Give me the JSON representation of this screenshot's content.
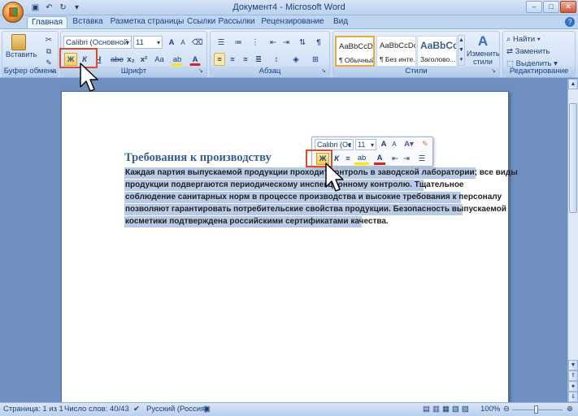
{
  "window": {
    "title": "Документ4 - Microsoft Word"
  },
  "quick_access": [
    "save",
    "undo",
    "redo",
    "customize"
  ],
  "tabs": [
    "Главная",
    "Вставка",
    "Разметка страницы",
    "Ссылки",
    "Рассылки",
    "Рецензирование",
    "Вид"
  ],
  "ribbon": {
    "clipboard": {
      "label": "Буфер обмена",
      "paste_label": "Вставить"
    },
    "font": {
      "label": "Шрифт",
      "font_name": "Calibri (Основной те",
      "font_size": "11",
      "bold_glyph": "Ж",
      "italic_glyph": "К",
      "underline_glyph": "Ч",
      "strike_glyph": "abe",
      "sub_glyph": "x₂",
      "sup_glyph": "x²",
      "case_glyph": "Aa",
      "grow_glyph": "A",
      "shrink_glyph": "A"
    },
    "paragraph": {
      "label": "Абзац"
    },
    "styles": {
      "label": "Стили",
      "cards": [
        {
          "sample": "AaBbCcDc",
          "name": "¶ Обычный"
        },
        {
          "sample": "AaBbCcDc",
          "name": "¶ Без инте..."
        },
        {
          "sample": "AaBbCc",
          "name": "Заголово..."
        }
      ],
      "change_label": "Изменить стили"
    },
    "editing": {
      "label": "Редактирование",
      "find": "Найти",
      "replace": "Заменить",
      "select": "Выделить"
    }
  },
  "minibar": {
    "font_name": "Calibri (Ос",
    "font_size": "11",
    "bold_glyph": "Ж",
    "italic_glyph": "К"
  },
  "document": {
    "heading": "Требования к производству",
    "lines": [
      "Каждая партия выпускаемой продукции проходит контроль в заводской лаборатории; все виды",
      "продукции подвергаются периодическому инспекционному контролю. Тщательное",
      "соблюдение санитарных норм в процессе производства и высокие требования к персоналу",
      "позволяют гарантировать потребительские свойства продукции.  Безопасность выпускаемой",
      "косметики подтверждена российскими сертификатами качества."
    ]
  },
  "status": {
    "page": "Страница: 1 из 1",
    "words": "Число слов: 40/43",
    "language": "Русский (Россия)",
    "zoom": "100%"
  },
  "colors": {
    "accent": "#e04a2b",
    "selection": "#b7cae6",
    "heading": "#365f91"
  }
}
